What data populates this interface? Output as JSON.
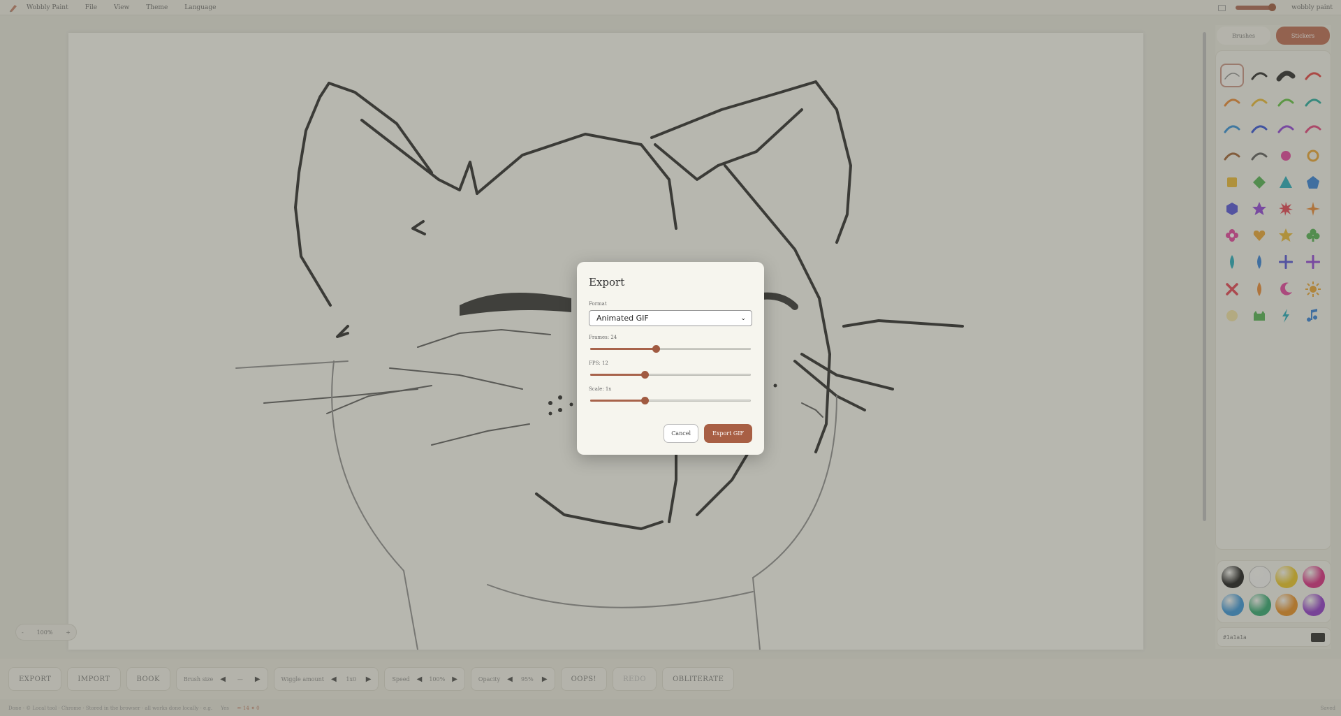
{
  "menubar": {
    "app_name": "Wobbly Paint",
    "items": [
      "File",
      "View",
      "Theme",
      "Language"
    ],
    "right_label": "wobbly paint"
  },
  "canvas_zoom": {
    "minus": "-",
    "value": "100%",
    "plus": "+"
  },
  "right_panel": {
    "tabs": [
      {
        "label": "Brushes",
        "active": false
      },
      {
        "label": "Stickers",
        "active": true
      }
    ],
    "palette": [
      "#111111",
      "#f4f4f4",
      "#e8c21a",
      "#d6207b",
      "#2f8fd6",
      "#27a36a",
      "#e68817",
      "#8a2fc6"
    ],
    "hex_value": "#1a1a1a"
  },
  "bottom_bar": {
    "export": "EXPORT",
    "import": "IMPORT",
    "book": "BOOK",
    "brush_size": {
      "label": "Brush size",
      "value": "—"
    },
    "wiggle": {
      "label": "Wiggle amount",
      "value": "1x0"
    },
    "speed": {
      "label": "Speed",
      "value": "100%"
    },
    "opacity": {
      "label": "Opacity",
      "value": "95%"
    },
    "oops": "OOPS!",
    "redo": "REDO",
    "obliterate": "OBLITERATE"
  },
  "status": {
    "path": "Done · © Local tool · Chrome · Stored in the browser · all works done locally · e.g.",
    "mid": "Yes",
    "icons": "✏ 14 ✦ 0",
    "right": "Saved"
  },
  "dialog": {
    "title": "Export",
    "format_label": "Format",
    "format_value": "Animated GIF",
    "frames_label": "Frames: 24",
    "frames_value": 0.41,
    "fps_label": "FPS: 12",
    "fps_value": 0.34,
    "scale_label": "Scale: 1x",
    "scale_value": 0.34,
    "cancel": "Cancel",
    "export": "Export GIF"
  }
}
